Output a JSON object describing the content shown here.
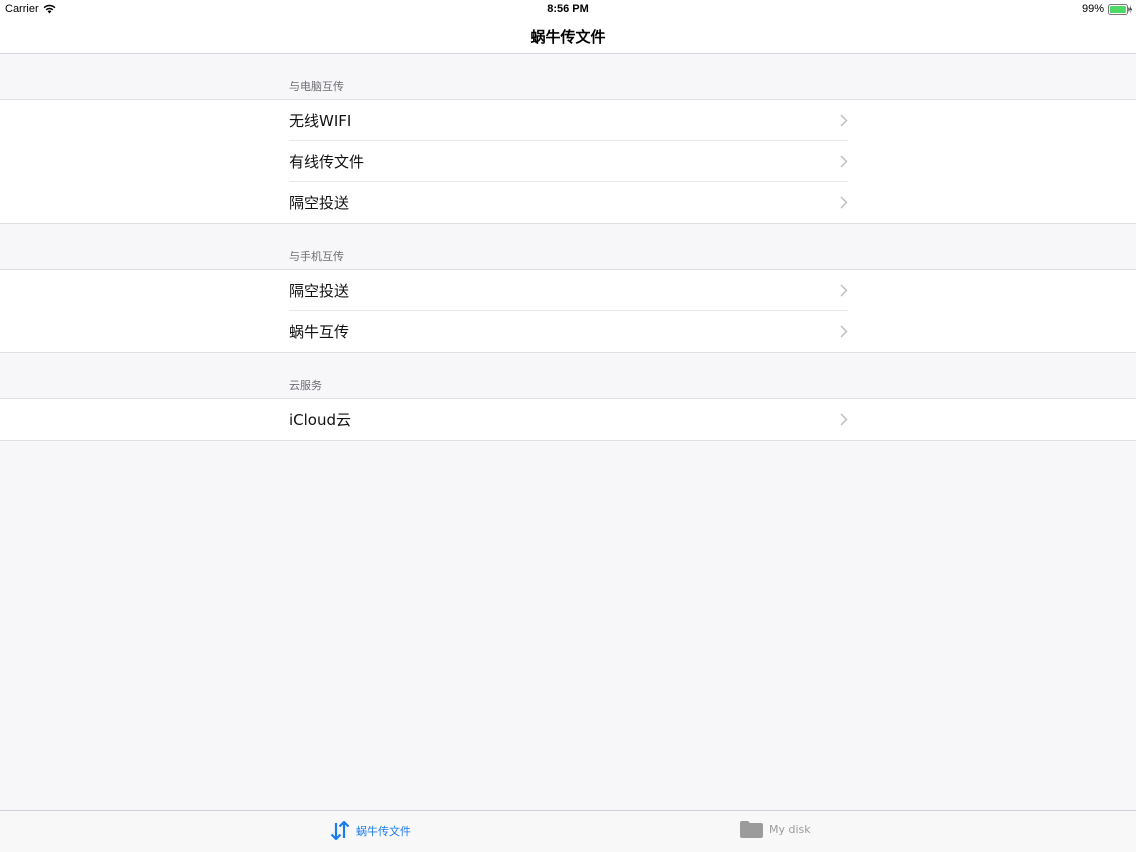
{
  "status_bar": {
    "carrier": "Carrier",
    "time": "8:56 PM",
    "battery": "99%",
    "battery_level": 0.99,
    "wifi_icon": "wifi-icon",
    "battery_icon": "battery-charging-icon"
  },
  "nav": {
    "title": "蜗牛传文件"
  },
  "sections": [
    {
      "header": "与电脑互传",
      "rows": [
        {
          "label": "无线WIFI"
        },
        {
          "label": "有线传文件"
        },
        {
          "label": "隔空投送"
        }
      ]
    },
    {
      "header": "与手机互传",
      "rows": [
        {
          "label": "隔空投送"
        },
        {
          "label": "蜗牛互传"
        }
      ]
    },
    {
      "header": "云服务",
      "rows": [
        {
          "label": "iCloud云"
        }
      ]
    }
  ],
  "tab_bar": {
    "tabs": [
      {
        "label": "蜗牛传文件",
        "icon": "transfer-arrows-icon",
        "selected": true
      },
      {
        "label": "My disk",
        "icon": "folder-icon",
        "selected": false
      }
    ]
  },
  "colors": {
    "accent": "#1a7cf0",
    "inactive": "#9b9b9b",
    "background": "#f7f6f9",
    "battery_green": "#4cd964"
  }
}
